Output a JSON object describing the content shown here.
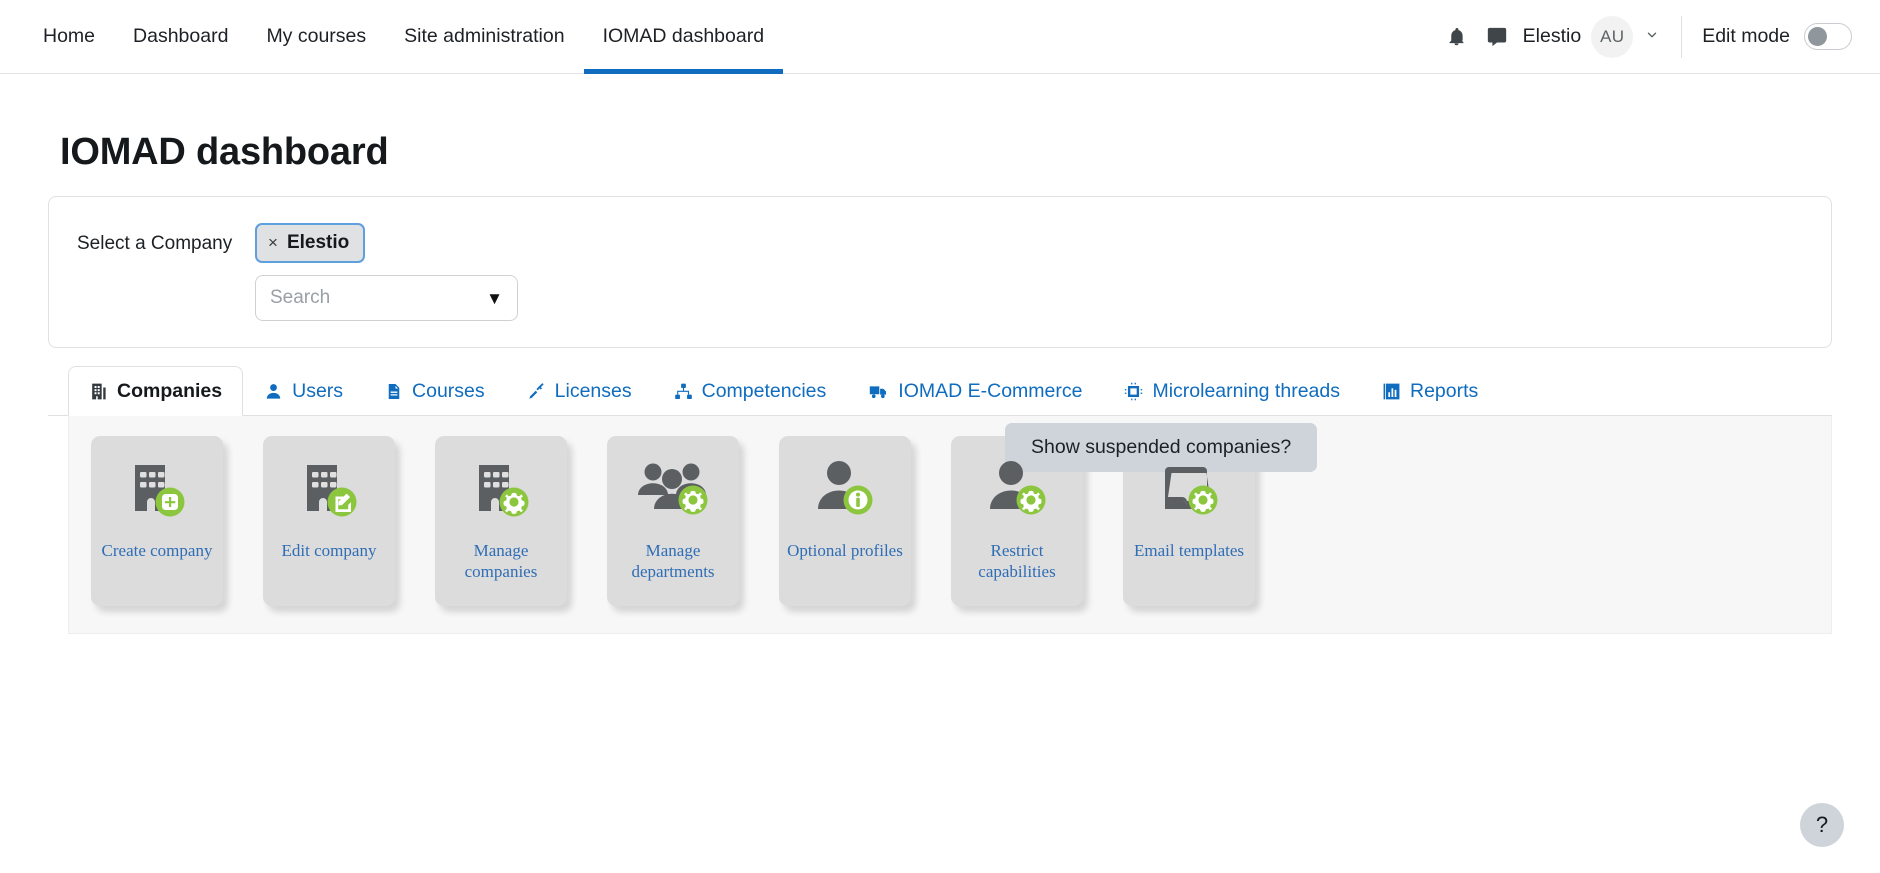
{
  "navbar": {
    "items": [
      {
        "label": "Home",
        "active": false
      },
      {
        "label": "Dashboard",
        "active": false
      },
      {
        "label": "My courses",
        "active": false
      },
      {
        "label": "Site administration",
        "active": false
      },
      {
        "label": "IOMAD dashboard",
        "active": true
      }
    ],
    "notifications_icon": "bell-icon",
    "messages_icon": "chat-bubble-icon",
    "user_name": "Elestio",
    "avatar_initials": "AU",
    "chevron": "⌄",
    "edit_mode_label": "Edit mode",
    "edit_mode_on": false
  },
  "page": {
    "title": "IOMAD dashboard"
  },
  "company_select": {
    "label": "Select a Company",
    "chip": {
      "remove_glyph": "×",
      "text": "Elestio"
    },
    "search_placeholder": "Search",
    "dropdown_caret": "▼",
    "suspended_button": "Show suspended companies?"
  },
  "tabs": [
    {
      "label": "Companies",
      "icon": "building-icon",
      "active": true
    },
    {
      "label": "Users",
      "icon": "user-icon",
      "active": false
    },
    {
      "label": "Courses",
      "icon": "file-text-icon",
      "active": false
    },
    {
      "label": "Licenses",
      "icon": "key-icon",
      "active": false
    },
    {
      "label": "Competencies",
      "icon": "sitemap-icon",
      "active": false
    },
    {
      "label": "IOMAD E-Commerce",
      "icon": "truck-icon",
      "active": false
    },
    {
      "label": "Microlearning threads",
      "icon": "microchip-icon",
      "active": false
    },
    {
      "label": "Reports",
      "icon": "bar-chart-icon",
      "active": false
    }
  ],
  "tiles": [
    {
      "label": "Create company",
      "icon": "building-plus-icon",
      "badge": "plus-badge"
    },
    {
      "label": "Edit company",
      "icon": "building-edit-icon",
      "badge": "pencil-badge"
    },
    {
      "label": "Manage companies",
      "icon": "building-gear-icon",
      "badge": "gear-badge"
    },
    {
      "label": "Manage departments",
      "icon": "users-gear-icon",
      "badge": "gear-badge"
    },
    {
      "label": "Optional profiles",
      "icon": "user-info-icon",
      "badge": "info-badge"
    },
    {
      "label": "Restrict capabilities",
      "icon": "user-gear-icon",
      "badge": "gear-badge"
    },
    {
      "label": "Email templates",
      "icon": "inbox-gear-icon",
      "badge": "gear-badge"
    }
  ],
  "help": {
    "glyph": "?"
  },
  "colors": {
    "link_blue": "#0f6cbf",
    "accent_green": "#8cc63f",
    "tile_gray": "#dcdcdc",
    "panel_gray": "#f7f7f7",
    "chip_border": "#5ea0dd",
    "button_gray": "#ced4da"
  }
}
